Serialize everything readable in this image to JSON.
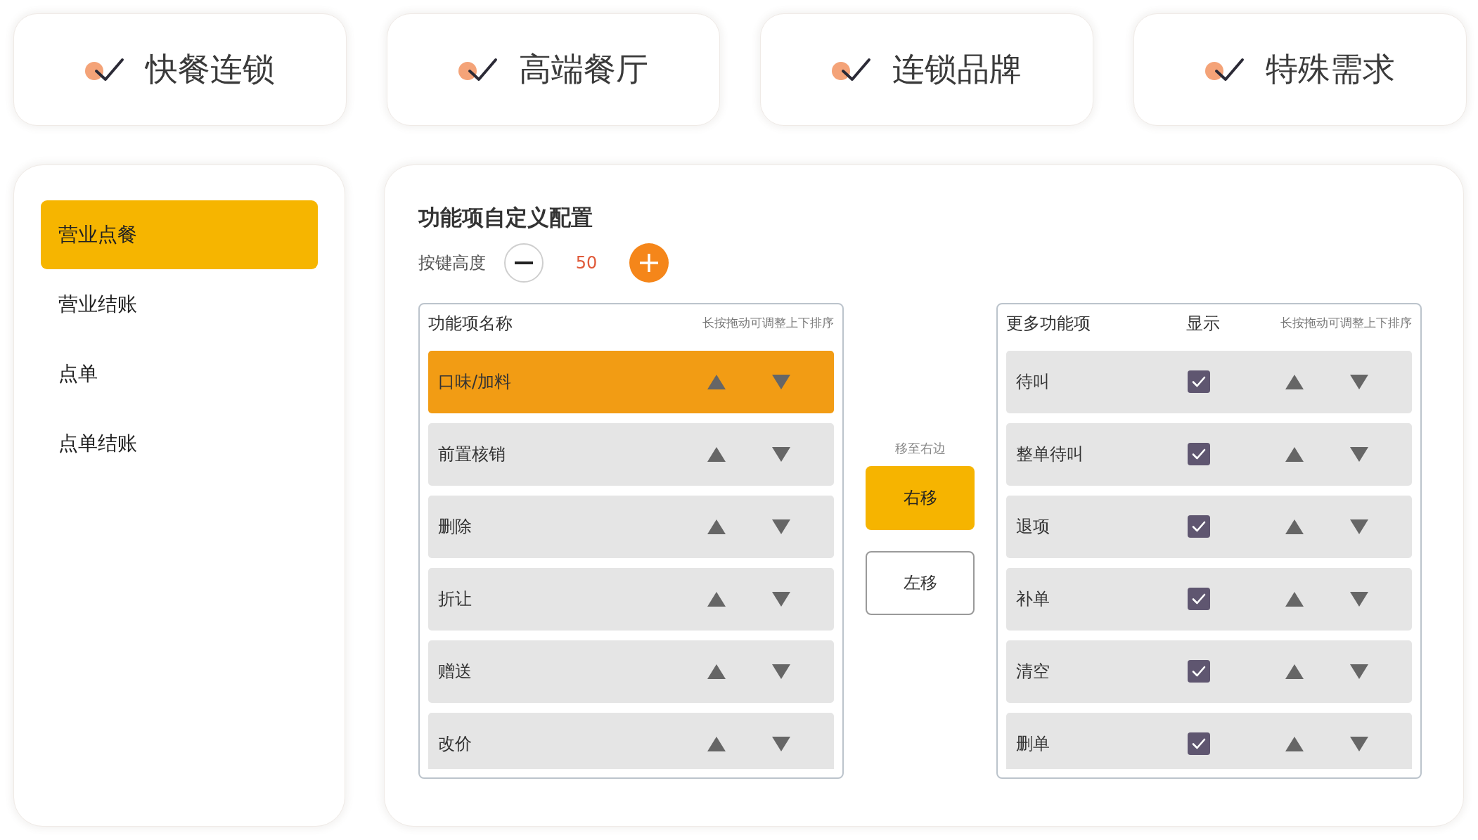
{
  "feature_cards": [
    {
      "label": "快餐连锁"
    },
    {
      "label": "高端餐厅"
    },
    {
      "label": "连锁品牌"
    },
    {
      "label": "特殊需求"
    }
  ],
  "sidebar": {
    "items": [
      {
        "label": "营业点餐",
        "selected": true
      },
      {
        "label": "营业结账",
        "selected": false
      },
      {
        "label": "点单",
        "selected": false
      },
      {
        "label": "点单结账",
        "selected": false
      }
    ]
  },
  "config": {
    "title": "功能项自定义配置",
    "button_height": {
      "label": "按键高度",
      "value": "50"
    },
    "left_list": {
      "title": "功能项名称",
      "hint": "长按拖动可调整上下排序",
      "rows": [
        {
          "name": "口味/加料",
          "selected": true
        },
        {
          "name": "前置核销",
          "selected": false
        },
        {
          "name": "删除",
          "selected": false
        },
        {
          "name": "折让",
          "selected": false
        },
        {
          "name": "赠送",
          "selected": false
        },
        {
          "name": "改价",
          "selected": false
        }
      ]
    },
    "move_hint": "移至右边",
    "move_buttons": [
      {
        "label": "右移",
        "kind": "primary"
      },
      {
        "label": "左移",
        "kind": "outline"
      }
    ],
    "right_list": {
      "title": "更多功能项",
      "show_column": "显示",
      "hint": "长按拖动可调整上下排序",
      "rows": [
        {
          "name": "待叫",
          "checked": true,
          "selected": false
        },
        {
          "name": "整单待叫",
          "checked": true,
          "selected": false
        },
        {
          "name": "退项",
          "checked": true,
          "selected": false
        },
        {
          "name": "补单",
          "checked": true,
          "selected": false
        },
        {
          "name": "清空",
          "checked": true,
          "selected": false
        },
        {
          "name": "删单",
          "checked": true,
          "selected": false
        }
      ]
    }
  }
}
